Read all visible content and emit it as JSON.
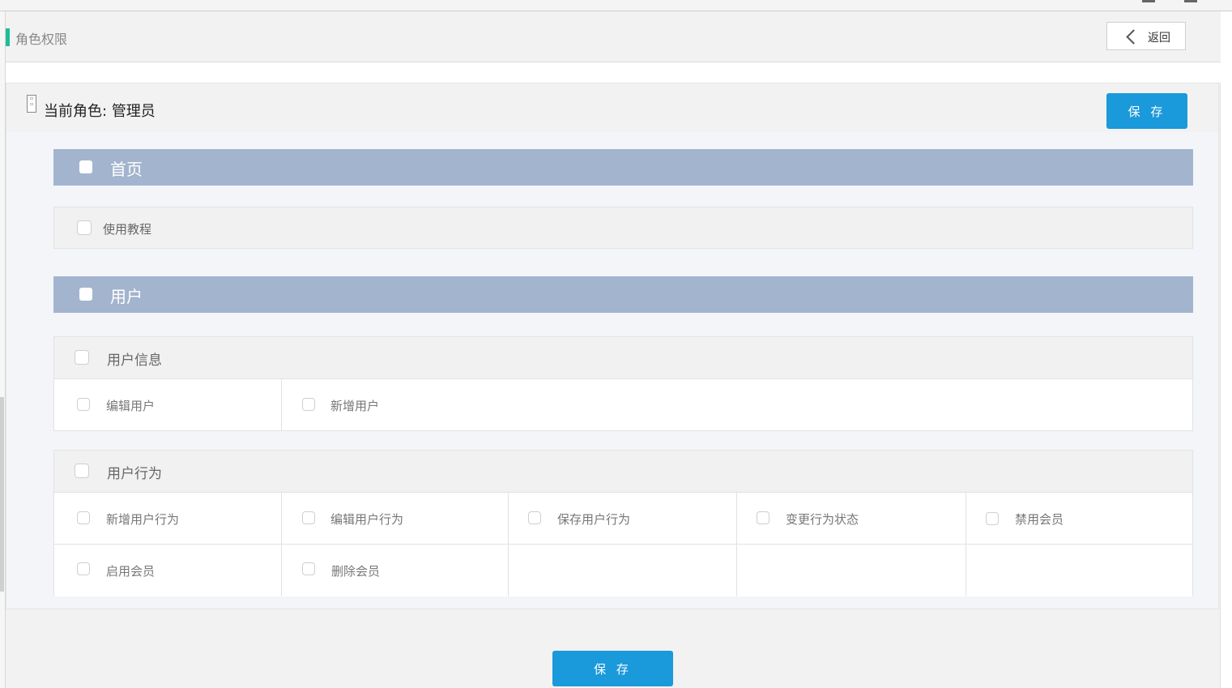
{
  "header": {
    "title": "角色权限",
    "back_label": "返回"
  },
  "role": {
    "prefix": "当前角色:",
    "name": "管理员"
  },
  "actions": {
    "save_top": "保 存",
    "save_bottom": "保 存"
  },
  "sections": {
    "home": {
      "label": "首页",
      "items": [
        "使用教程"
      ]
    },
    "user": {
      "label": "用户",
      "groups": {
        "info": {
          "label": "用户信息",
          "items": [
            "编辑用户",
            "新增用户"
          ]
        },
        "behavior": {
          "label": "用户行为",
          "items": [
            "新增用户行为",
            "编辑用户行为",
            "保存用户行为",
            "变更行为状态",
            "禁用会员",
            "启用会员",
            "删除会员"
          ]
        }
      }
    }
  },
  "icons": {
    "back": "chevron-left-icon",
    "role": "role-icon"
  },
  "colors": {
    "accent": "#1fbd95",
    "primary": "#1a99db",
    "section_bar": "#a3b4ce"
  }
}
